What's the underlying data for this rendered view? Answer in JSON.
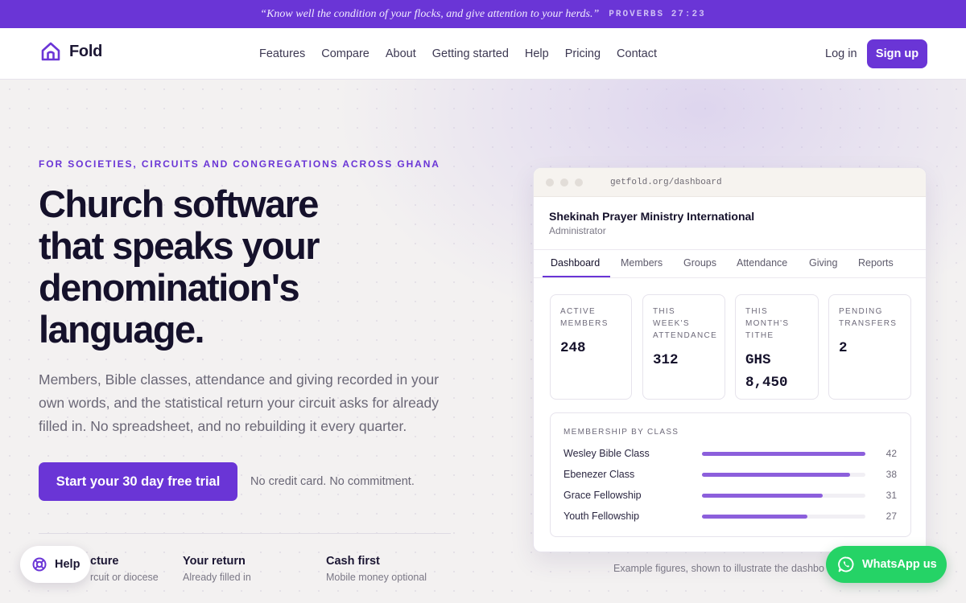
{
  "banner": {
    "quote": "“Know well the condition of your flocks, and give attention to your herds.”",
    "reference": "PROVERBS 27:23"
  },
  "nav": {
    "brand": "Fold",
    "brand_icon": "house-icon",
    "links": [
      "Features",
      "Compare",
      "About",
      "Getting started",
      "Help",
      "Pricing",
      "Contact"
    ],
    "login": "Log in",
    "signup": "Sign up"
  },
  "hero": {
    "eyebrow": "FOR SOCIETIES, CIRCUITS AND CONGREGATIONS ACROSS GHANA",
    "headline": "Church software that speaks your denomination's language.",
    "lede": "Members, Bible classes, attendance and giving recorded in your own words, and the statistical return your circuit asks for already filled in. No spreadsheet, and no rebuilding it every quarter.",
    "cta": "Start your 30 day free trial",
    "cta_note": "No credit card. No commitment."
  },
  "features": [
    {
      "title": "cture",
      "subtitle": "rcuit or diocese"
    },
    {
      "title": "Your return",
      "subtitle": "Already filled in"
    },
    {
      "title": "Cash first",
      "subtitle": "Mobile money optional"
    }
  ],
  "dashboard": {
    "url": "getfold.org/dashboard",
    "org_name": "Shekinah Prayer Ministry International",
    "role": "Administrator",
    "tabs": [
      "Dashboard",
      "Members",
      "Groups",
      "Attendance",
      "Giving",
      "Reports"
    ],
    "active_tab": "Dashboard",
    "stats": [
      {
        "label": "ACTIVE MEMBERS",
        "value": "248"
      },
      {
        "label": "THIS WEEK'S ATTENDANCE",
        "value": "312"
      },
      {
        "label": "THIS MONTH'S TITHE",
        "value": "GHS 8,450"
      },
      {
        "label": "PENDING TRANSFERS",
        "value": "2"
      }
    ],
    "membership_title": "MEMBERSHIP BY CLASS",
    "classes": [
      {
        "name": "Wesley Bible Class",
        "count": "42",
        "fraction": 1.0
      },
      {
        "name": "Ebenezer Class",
        "count": "38",
        "fraction": 0.905
      },
      {
        "name": "Grace Fellowship",
        "count": "31",
        "fraction": 0.738
      },
      {
        "name": "Youth Fellowship",
        "count": "27",
        "fraction": 0.643
      }
    ],
    "caption": "Example figures, shown to illustrate the dashbo"
  },
  "floating": {
    "help": "Help",
    "help_icon": "lifebuoy-icon",
    "whatsapp": "WhatsApp us",
    "whatsapp_icon": "whatsapp-icon"
  },
  "colors": {
    "brand": "#6a35d6",
    "whatsapp": "#25d366",
    "bar_fill": "#8c5fdc"
  }
}
